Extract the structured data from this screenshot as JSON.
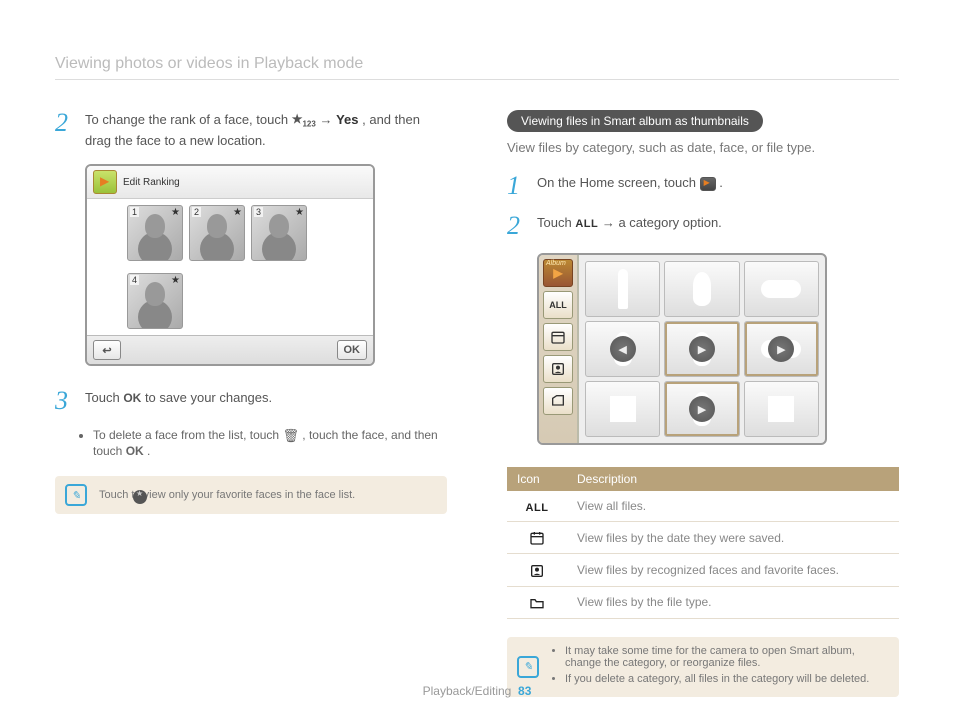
{
  "header": "Viewing photos or videos in Playback mode",
  "left": {
    "step2": {
      "num": "2",
      "pre": "To change the rank of a face, touch ",
      "mid": " → ",
      "yes": "Yes",
      "post": ", and then drag the face to a new location."
    },
    "screen": {
      "title": "Edit Ranking",
      "faces": [
        "1",
        "2",
        "3",
        "4"
      ],
      "ok": "OK"
    },
    "step3": {
      "num": "3",
      "pre": "Touch ",
      "ok": "OK",
      "post": " to save your changes."
    },
    "bullet": {
      "a": "To delete a face from the list, touch ",
      "b": ", touch the face, and then touch ",
      "ok": "OK",
      "c": "."
    },
    "note": "Touch        to view only your favorite faces in the face list."
  },
  "right": {
    "pill": "Viewing files in Smart album as thumbnails",
    "intro": "View files by category, such as date, face, or file type.",
    "step1": {
      "num": "1",
      "pre": "On the Home screen, touch ",
      "post": "."
    },
    "step2": {
      "num": "2",
      "pre": "Touch ",
      "all": "ALL",
      "post": " → a category option."
    },
    "sidebar": {
      "album": "Album",
      "all": "ALL"
    },
    "table": {
      "h1": "Icon",
      "h2": "Description",
      "r1": {
        "icon": "ALL",
        "desc": "View all files."
      },
      "r2": {
        "desc": "View files by the date they were saved."
      },
      "r3": {
        "desc": "View files by recognized faces and favorite faces."
      },
      "r4": {
        "desc": "View files by the file type."
      }
    },
    "note": {
      "li1": "It may take some time for the camera to open Smart album, change the category, or reorganize files.",
      "li2": "If you delete a category, all files in the category will be deleted."
    }
  },
  "footer": {
    "section": "Playback/Editing",
    "page": "83"
  }
}
